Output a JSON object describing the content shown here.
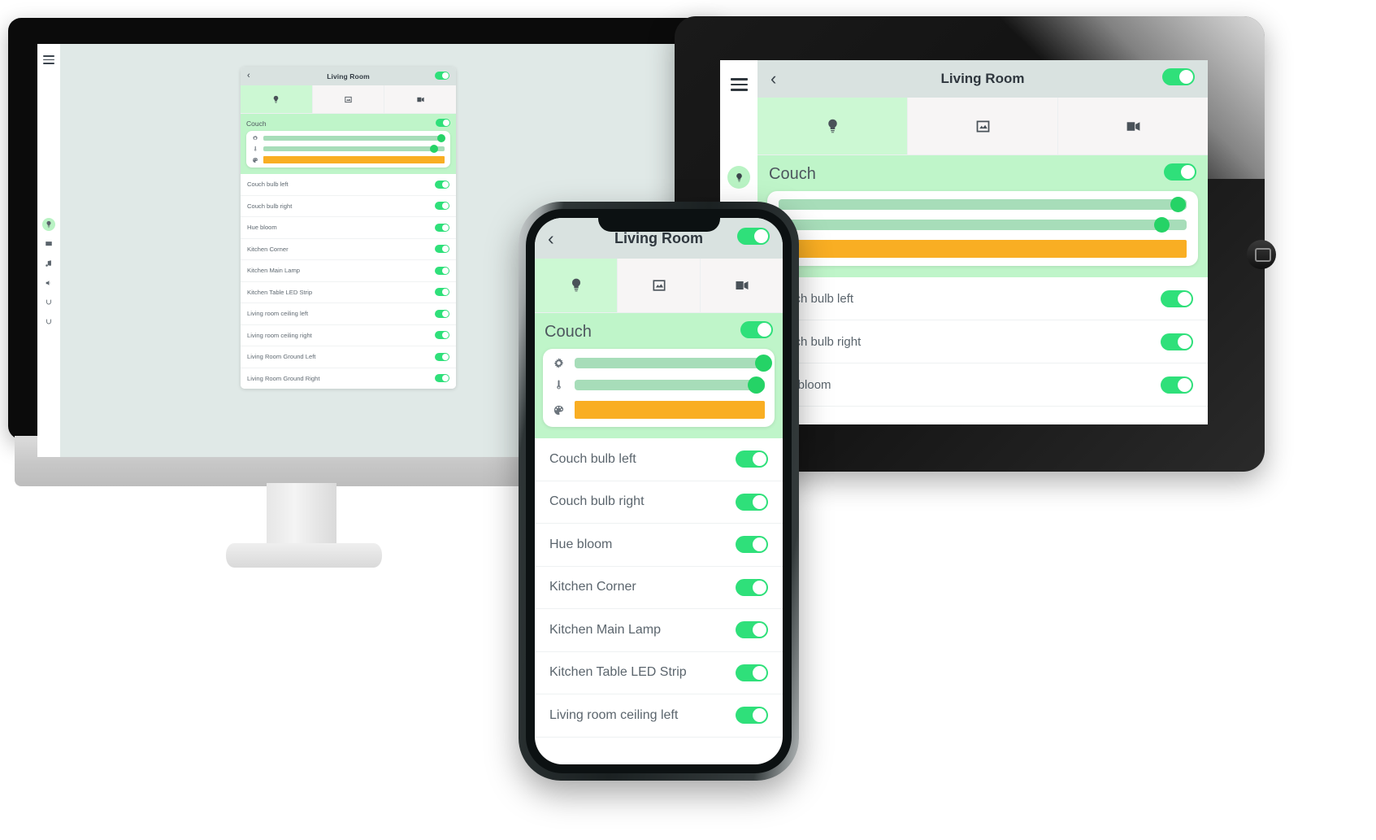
{
  "app": {
    "title": "Living Room",
    "back_label": "‹",
    "colors": {
      "accent_green": "#2fe07a",
      "group_green": "#bff5c9",
      "tab_active": "#ccf8d3",
      "slider_track": "#a7ddb9",
      "slider_amber": "#f9ae23",
      "topbar": "#d9e2e0",
      "text": "#5b656d"
    },
    "tabs": [
      {
        "id": "lights",
        "icon": "lightbulb-icon",
        "active": true
      },
      {
        "id": "media",
        "icon": "image-icon",
        "active": false
      },
      {
        "id": "camera",
        "icon": "video-camera-icon",
        "active": false
      }
    ],
    "group": {
      "name": "Couch",
      "toggle_on": true,
      "sliders": [
        {
          "id": "brightness",
          "icon": "brightness-icon",
          "value": 97,
          "style": "green"
        },
        {
          "id": "color-temperature",
          "icon": "thermometer-icon",
          "value": 93,
          "style": "green"
        },
        {
          "id": "color",
          "icon": "palette-icon",
          "value": 100,
          "style": "amber"
        }
      ]
    },
    "lights": [
      {
        "name": "Couch bulb left",
        "on": true
      },
      {
        "name": "Couch bulb right",
        "on": true
      },
      {
        "name": "Hue bloom",
        "on": true
      },
      {
        "name": "Kitchen Corner",
        "on": true
      },
      {
        "name": "Kitchen Main Lamp",
        "on": true
      },
      {
        "name": "Kitchen Table LED Strip",
        "on": true
      },
      {
        "name": "Living room ceiling left",
        "on": true
      },
      {
        "name": "Living room ceiling right",
        "on": true
      },
      {
        "name": "Living Room Ground Left",
        "on": true
      },
      {
        "name": "Living Room Ground Right",
        "on": true
      }
    ],
    "sidebar": {
      "menu_icon": "hamburger-menu-icon",
      "items": [
        {
          "id": "lights",
          "icon": "lightbulb-icon",
          "active": true
        },
        {
          "id": "screens",
          "icon": "screen-icon",
          "active": false
        },
        {
          "id": "music",
          "icon": "music-note-icon",
          "active": false
        },
        {
          "id": "volume",
          "icon": "speaker-icon",
          "active": false
        },
        {
          "id": "scenes",
          "icon": "refresh-icon",
          "active": false
        },
        {
          "id": "automations",
          "icon": "refresh-icon",
          "active": false
        }
      ]
    }
  },
  "devices": {
    "desktop": {
      "label": "desktop-monitor"
    },
    "tablet": {
      "label": "tablet"
    },
    "phone": {
      "label": "smartphone"
    }
  }
}
